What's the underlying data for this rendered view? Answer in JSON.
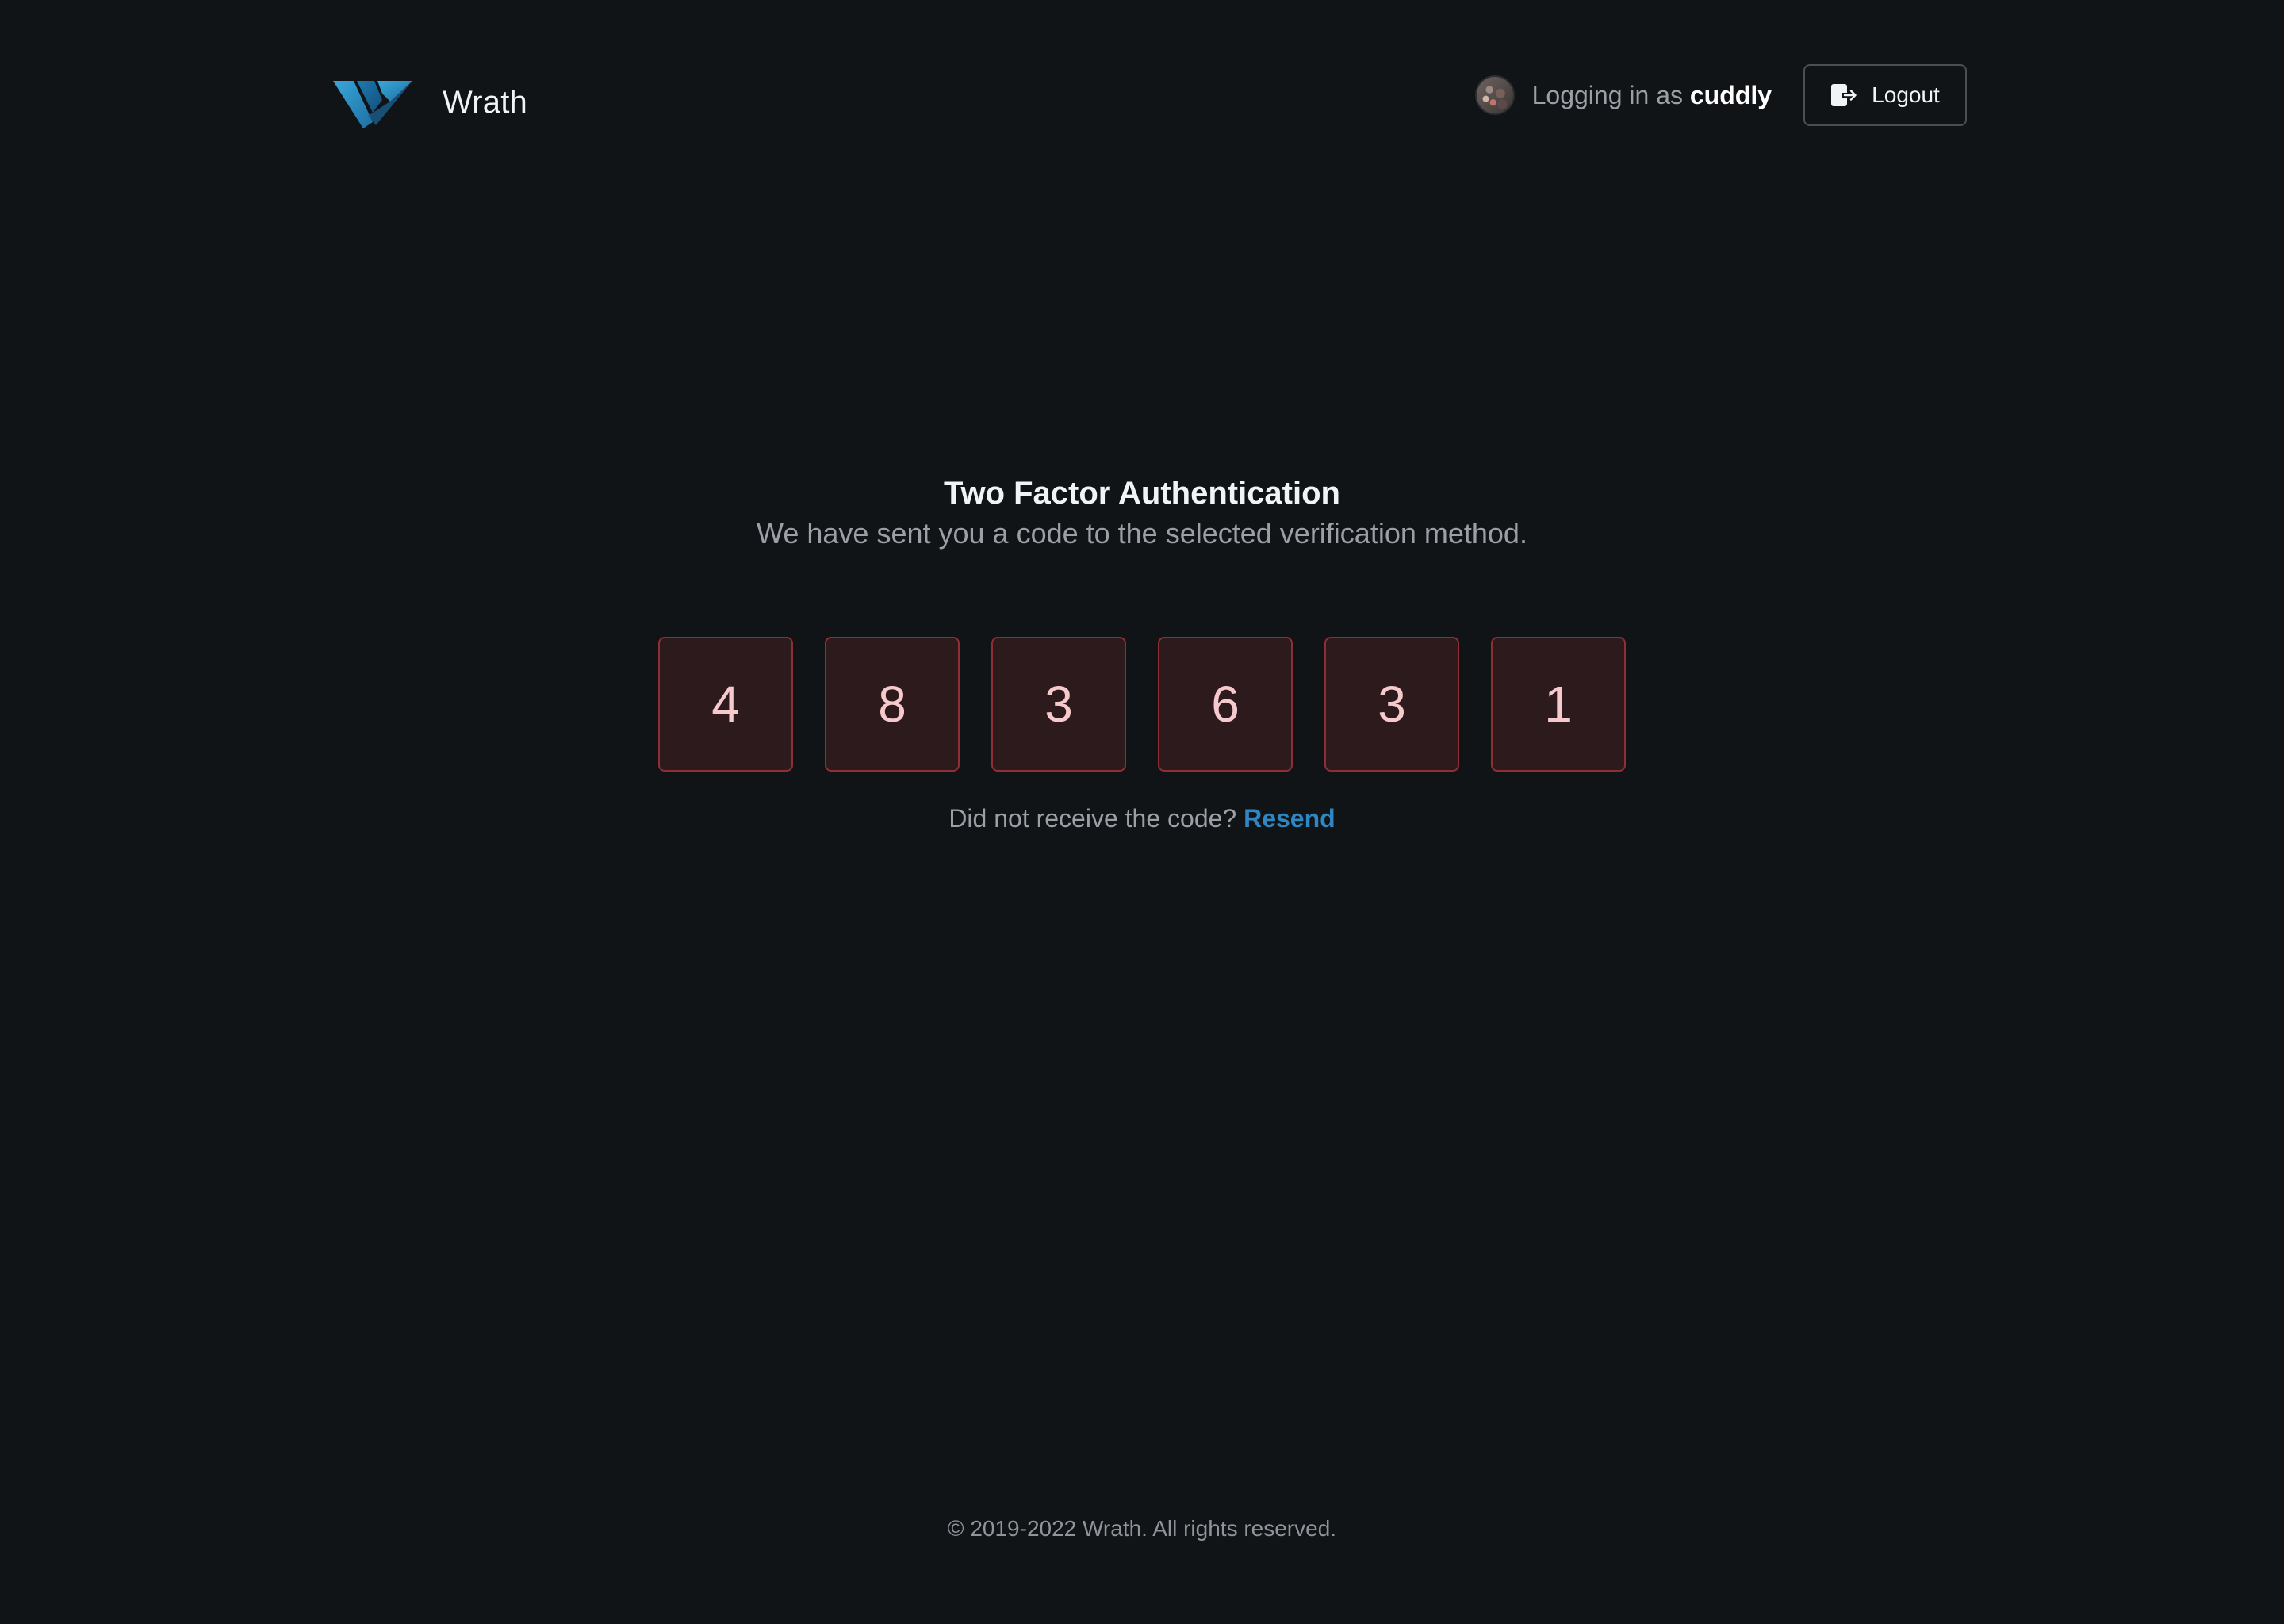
{
  "brand": {
    "name": "Wrath",
    "logo_icon": "wrath-logo-icon",
    "accent": "#2f86c3"
  },
  "header": {
    "login_prefix": "Logging in as",
    "username": "cuddly",
    "avatar": "user-avatar",
    "logout_label": "Logout",
    "logout_icon": "logout-icon"
  },
  "auth": {
    "title": "Two Factor Authentication",
    "subtitle": "We have sent you a code to the selected verification method.",
    "code_digits": [
      "4",
      "8",
      "3",
      "6",
      "3",
      "1"
    ],
    "error_color": "#8f2f33",
    "resend_prompt": "Did not receive the code?",
    "resend_label": "Resend"
  },
  "footer": {
    "copyright": "© 2019-2022 Wrath. All rights reserved."
  }
}
